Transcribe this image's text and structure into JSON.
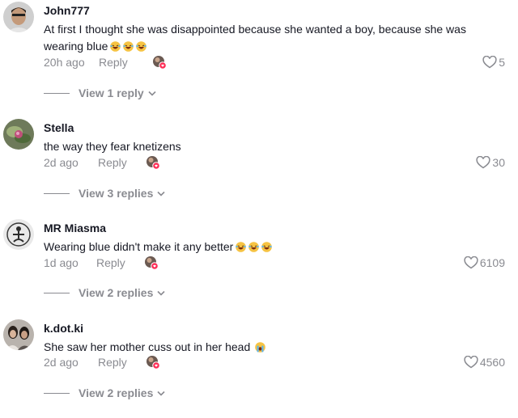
{
  "comments": [
    {
      "username": "John777",
      "text": "At first I thought she was disappointed because she wanted a boy, because she was wearing blue",
      "emojis": [
        "laughing-emoji",
        "laughing-emoji",
        "laughing-emoji"
      ],
      "time": "20h ago",
      "reply_label": "Reply",
      "likes": "5",
      "view_replies": "View 1 reply"
    },
    {
      "username": "Stella",
      "text": "the way they fear knetizens",
      "emojis": [],
      "time": "2d ago",
      "reply_label": "Reply",
      "likes": "30",
      "view_replies": "View 3 replies"
    },
    {
      "username": "MR Miasma",
      "text": "Wearing blue didn't make it any better",
      "emojis": [
        "laughing-emoji",
        "laughing-emoji",
        "laughing-emoji"
      ],
      "time": "1d ago",
      "reply_label": "Reply",
      "likes": "6109",
      "view_replies": "View 2 replies"
    },
    {
      "username": "k.dot.ki",
      "text": "She saw her mother cuss out in her head",
      "emojis": [
        "crying-emoji"
      ],
      "time": "2d ago",
      "reply_label": "Reply",
      "likes": "4560",
      "view_replies": "View 2 replies"
    }
  ],
  "colors": {
    "text": "#161823",
    "muted": "#8a8b91",
    "creator_badge": "#fe2c55"
  }
}
